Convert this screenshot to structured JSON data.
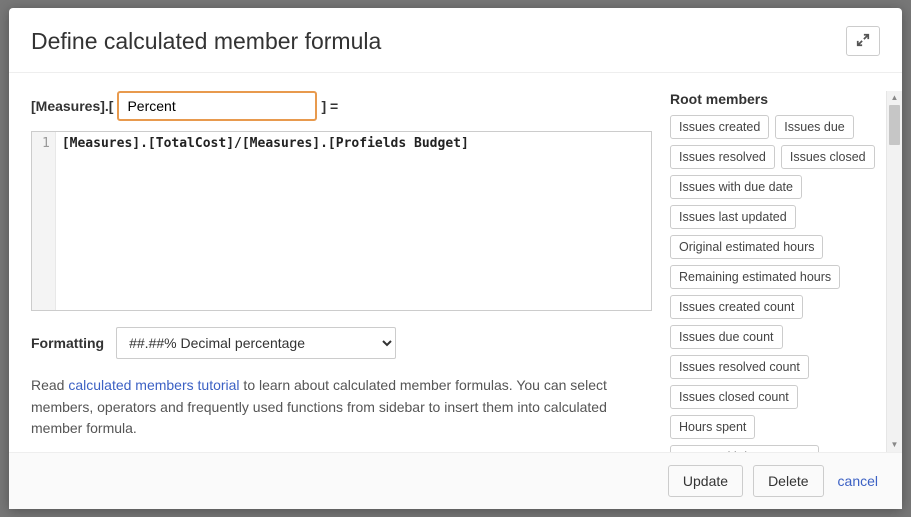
{
  "title": "Define calculated member formula",
  "measure": {
    "prefix": "[Measures].[",
    "name": "Percent",
    "suffix": "] ="
  },
  "editor": {
    "line_number": "1",
    "content": "[Measures].[TotalCost]/[Measures].[Profields Budget]"
  },
  "formatting": {
    "label": "Formatting",
    "selected": "##.##% Decimal percentage"
  },
  "hint": {
    "before": "Read ",
    "link": "calculated members tutorial",
    "after": " to learn about calculated member formulas. You can select members, operators and frequently used functions from sidebar to insert them into calculated member formula."
  },
  "root": {
    "title": "Root members",
    "items": [
      "Issues created",
      "Issues due",
      "Issues resolved",
      "Issues closed",
      "Issues with due date",
      "Issues last updated",
      "Original estimated hours",
      "Remaining estimated hours",
      "Issues created count",
      "Issues due count",
      "Issues resolved count",
      "Issues closed count",
      "Hours spent",
      "Issues with hours spent"
    ]
  },
  "footer": {
    "update": "Update",
    "delete": "Delete",
    "cancel": "cancel"
  }
}
